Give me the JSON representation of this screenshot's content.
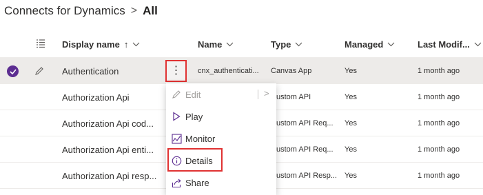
{
  "breadcrumb": {
    "parent": "Connects for Dynamics",
    "separator": ">",
    "current": "All"
  },
  "columns": {
    "display_name": "Display name",
    "sort_glyph": "↑",
    "name": "Name",
    "type": "Type",
    "managed": "Managed",
    "last_modified": "Last Modif..."
  },
  "rows": [
    {
      "display_name": "Authentication",
      "name": "cnx_authenticati...",
      "type": "Canvas App",
      "managed": "Yes",
      "last_modified": "1 month ago"
    },
    {
      "display_name": "Authorization Api",
      "name": "",
      "type": "ustom API",
      "managed": "Yes",
      "last_modified": "1 month ago"
    },
    {
      "display_name": "Authorization Api cod...",
      "name": "",
      "type": "ustom API Req...",
      "managed": "Yes",
      "last_modified": "1 month ago"
    },
    {
      "display_name": "Authorization Api enti...",
      "name": "",
      "type": "ustom API Req...",
      "managed": "Yes",
      "last_modified": "1 month ago"
    },
    {
      "display_name": "Authorization Api resp...",
      "name": "",
      "type": "ustom API Resp...",
      "managed": "Yes",
      "last_modified": "1 month ago"
    }
  ],
  "more_button": {
    "glyph": "⋮"
  },
  "context_menu": {
    "items": [
      {
        "label": "Edit",
        "icon": "pencil-icon",
        "disabled": true
      },
      {
        "label": "Play",
        "icon": "play-icon"
      },
      {
        "label": "Monitor",
        "icon": "monitor-icon"
      },
      {
        "label": "Details",
        "icon": "info-icon"
      },
      {
        "label": "Share",
        "icon": "share-icon"
      }
    ],
    "edit_arrow": ">"
  },
  "colors": {
    "accent": "#5c2d91",
    "highlight_border": "#e03131",
    "selected_row": "#edebe9"
  }
}
